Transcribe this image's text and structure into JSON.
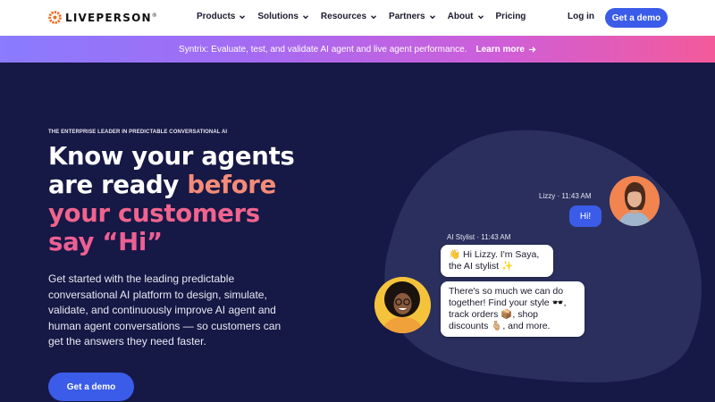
{
  "header": {
    "logo_text": "LIVEPERSON",
    "logo_mark": "®",
    "nav": [
      {
        "label": "Products",
        "has_dropdown": true
      },
      {
        "label": "Solutions",
        "has_dropdown": true
      },
      {
        "label": "Resources",
        "has_dropdown": true
      },
      {
        "label": "Partners",
        "has_dropdown": true
      },
      {
        "label": "About",
        "has_dropdown": true
      },
      {
        "label": "Pricing",
        "has_dropdown": false
      }
    ],
    "login_label": "Log in",
    "demo_label": "Get a demo"
  },
  "banner": {
    "text": "Syntrix: Evaluate, test, and validate AI agent and live agent performance.",
    "link_label": "Learn more",
    "link_icon": "arrow-right-icon"
  },
  "hero": {
    "eyebrow": "THE ENTERPRISE LEADER IN PREDICTABLE CONVERSATIONAL AI",
    "headline": {
      "line1": "Know your agents",
      "line2_white": "are ready ",
      "line2_accent": "before",
      "line3": "your customers",
      "line4": "say “Hi”"
    },
    "subcopy": "Get started with the leading predictable conversational AI platform to design, simulate, validate, and continuously improve AI agent and human agent conversations — so customers can get the answers they need faster.",
    "cta_label": "Get a demo"
  },
  "chat": {
    "user_meta": "Lizzy · 11:43 AM",
    "user_message": "Hi!",
    "bot_meta": "AI Stylist · 11:43 AM",
    "bot_message_1": "👋 Hi Lizzy. I'm Saya, the AI stylist ✨",
    "bot_message_2": "There's so much we can do together! Find your style 🕶️, track orders 📦, shop discounts 🫰🏼, and more."
  },
  "colors": {
    "hero_bg": "#161845",
    "blob": "#2b2f5e",
    "primary": "#3b5ce8",
    "accent_orange": "#f48b78",
    "accent_pink": "#ee5f94",
    "logo_orange": "#f26b21"
  }
}
